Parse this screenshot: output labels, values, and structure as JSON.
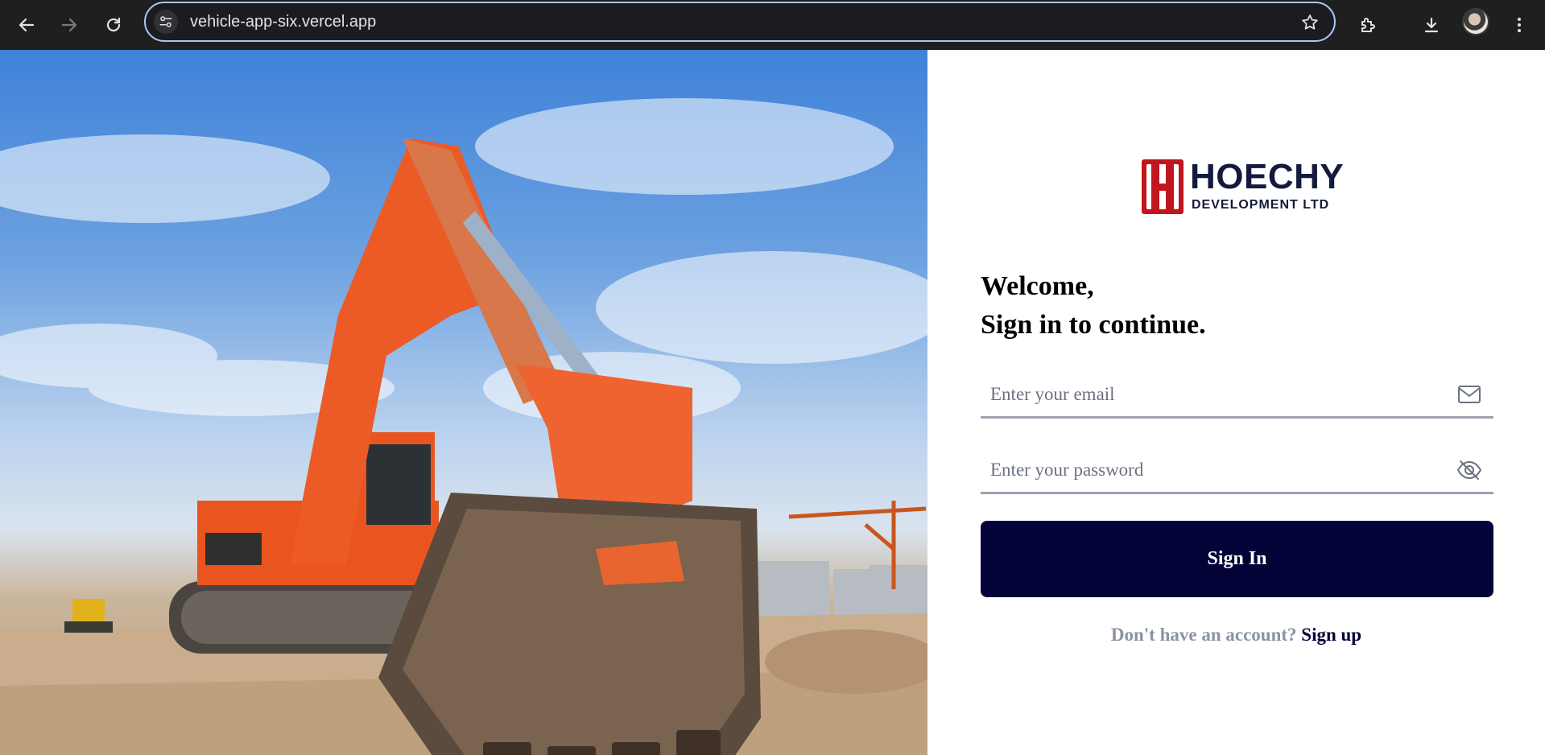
{
  "browser": {
    "url": "vehicle-app-six.vercel.app",
    "icons": {
      "back": "arrow-left-icon",
      "forward": "arrow-right-icon",
      "reload": "reload-icon",
      "site_info": "tune-icon",
      "bookmark": "star-icon",
      "extensions": "puzzle-icon",
      "downloads": "download-icon",
      "profile": "avatar",
      "menu": "kebab-menu-icon"
    },
    "colors": {
      "toolbar": "#1f1f1f",
      "omnibox_border": "#a8c7fa"
    }
  },
  "hero": {
    "subject": "orange excavator on construction site",
    "colors": {
      "machine": "#ec5a26",
      "sky": "#4f8fdc",
      "ground": "#c7ab8a"
    }
  },
  "logo": {
    "name": "HOECHY",
    "subtitle": "DEVELOPMENT LTD",
    "mark": "H",
    "colors": {
      "mark": "#c1161d",
      "text": "#141a3c"
    }
  },
  "form": {
    "welcome_line1": "Welcome,",
    "welcome_line2": "Sign in to continue.",
    "email_placeholder": "Enter your email",
    "email_value": "",
    "email_icon": "mail-icon",
    "password_placeholder": "Enter your password",
    "password_value": "",
    "password_icon": "eye-off-icon",
    "submit_label": "Sign In",
    "signup_prompt": "Don't have an account?",
    "signup_link": "Sign up",
    "colors": {
      "button": "#030338",
      "prompt": "#8a93a5",
      "underline": "#9ca3af"
    }
  }
}
